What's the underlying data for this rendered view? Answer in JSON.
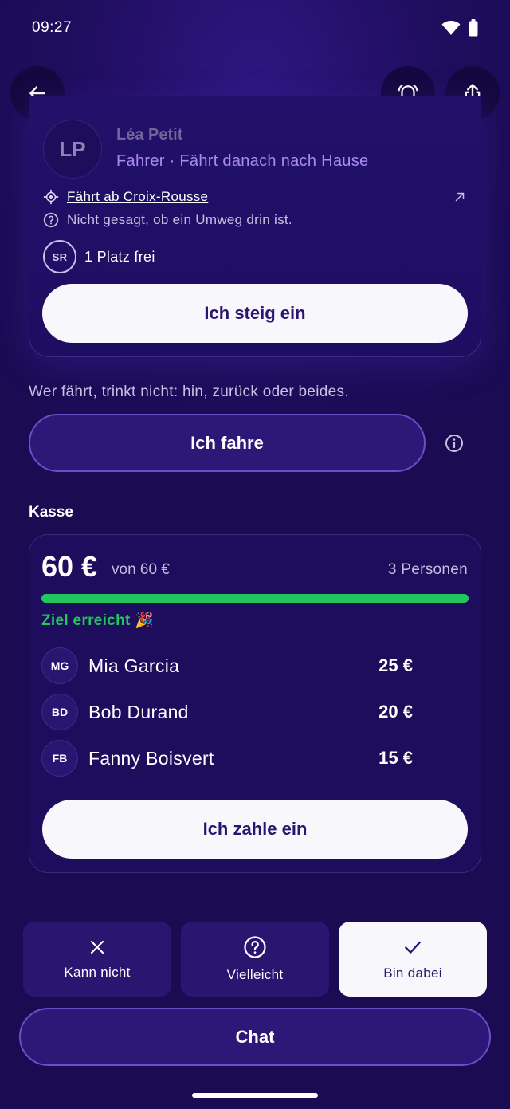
{
  "status_bar": {
    "time": "09:27"
  },
  "driver_card": {
    "initials": "LP",
    "name": "Léa Petit",
    "subtitle": "Fahrer · Fährt danach nach Hause",
    "departure": "Fährt ab Croix-Rousse",
    "detour_note": "Nicht gesagt, ob ein Umweg drin ist.",
    "seat_badge": "SR",
    "seats": "1 Platz frei",
    "join_button": "Ich steig ein"
  },
  "drive_info": "Wer fährt, trinkt nicht: hin, zurück oder beides.",
  "drive_button": "Ich fahre",
  "kasse": {
    "title": "Kasse",
    "amount": "60 €",
    "goal_text": "von 60 €",
    "persons": "3 Personen",
    "progress": 1.0,
    "goal_reached": "Ziel erreicht 🎉",
    "contributors": [
      {
        "initials": "MG",
        "name": "Mia Garcia",
        "amount": "25 €"
      },
      {
        "initials": "BD",
        "name": "Bob Durand",
        "amount": "20 €"
      },
      {
        "initials": "FB",
        "name": "Fanny Boisvert",
        "amount": "15 €"
      }
    ],
    "pay_button": "Ich zahle ein"
  },
  "rsvp": {
    "cant": "Kann nicht",
    "maybe": "Vielleicht",
    "going": "Bin dabei",
    "selected": "going"
  },
  "chat_button": "Chat",
  "colors": {
    "background": "#1a0b52",
    "accent_green": "#22c55e",
    "accent_purple": "#6b4fc7"
  }
}
